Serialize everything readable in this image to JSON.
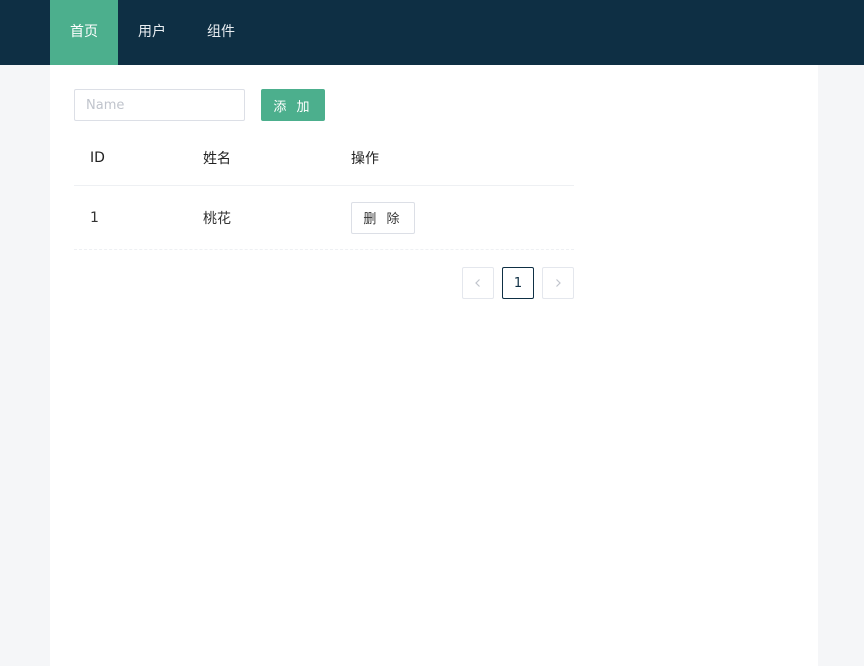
{
  "nav": {
    "items": [
      {
        "label": "首页",
        "active": true
      },
      {
        "label": "用户",
        "active": false
      },
      {
        "label": "组件",
        "active": false
      }
    ]
  },
  "form": {
    "name_placeholder": "Name",
    "name_value": "",
    "add_label": "添 加"
  },
  "table": {
    "columns": [
      "ID",
      "姓名",
      "操作"
    ],
    "rows": [
      {
        "id": "1",
        "name": "桃花",
        "action": "删 除"
      }
    ]
  },
  "pagination": {
    "current_page": "1",
    "prev_icon": "chevron-left-icon",
    "next_icon": "chevron-right-icon"
  },
  "colors": {
    "header_bg": "#0e2f44",
    "accent": "#4caf8d",
    "page_bg": "#f5f6f8"
  }
}
